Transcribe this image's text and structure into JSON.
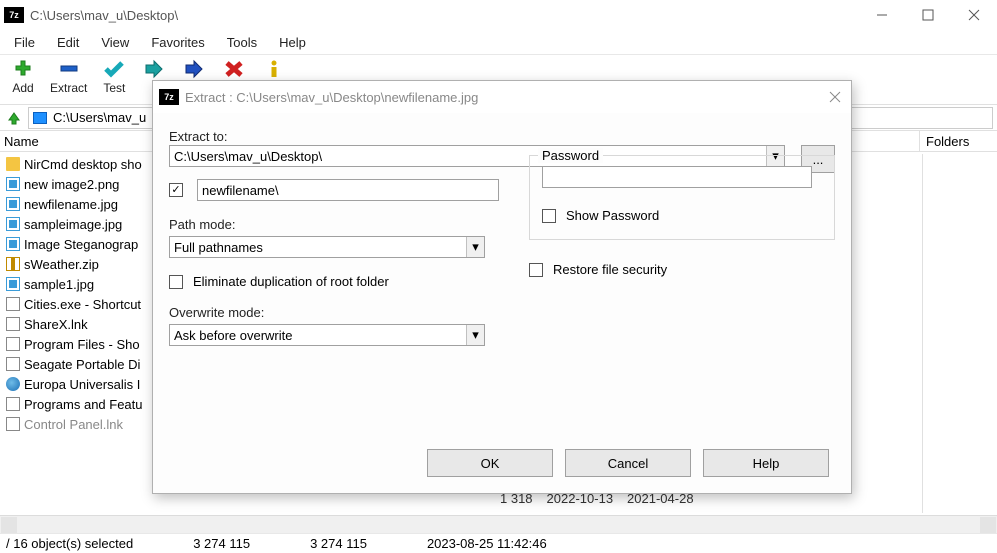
{
  "window": {
    "title": "C:\\Users\\mav_u\\Desktop\\",
    "app_badge": "7z"
  },
  "menu": {
    "items": [
      "File",
      "Edit",
      "View",
      "Favorites",
      "Tools",
      "Help"
    ]
  },
  "toolbar": {
    "add": "Add",
    "extract": "Extract",
    "test": "Test"
  },
  "address": "C:\\Users\\mav_u",
  "columns": {
    "left": "Name",
    "right": "Folders"
  },
  "files": [
    {
      "icon": "folder",
      "name": "NirCmd desktop sho"
    },
    {
      "icon": "img",
      "name": "new image2.png"
    },
    {
      "icon": "img",
      "name": "newfilename.jpg"
    },
    {
      "icon": "img",
      "name": "sampleimage.jpg"
    },
    {
      "icon": "img",
      "name": "Image Steganograp"
    },
    {
      "icon": "zip",
      "name": "sWeather.zip"
    },
    {
      "icon": "img",
      "name": "sample1.jpg"
    },
    {
      "icon": "lnk",
      "name": "Cities.exe - Shortcut"
    },
    {
      "icon": "lnk",
      "name": "ShareX.lnk"
    },
    {
      "icon": "lnk",
      "name": "Program Files - Sho"
    },
    {
      "icon": "lnk",
      "name": "Seagate Portable Di"
    },
    {
      "icon": "globe",
      "name": "Europa Universalis I"
    },
    {
      "icon": "lnk",
      "name": "Programs and Featu"
    },
    {
      "icon": "lnk",
      "name": "Control Panel.lnk",
      "faded": true
    }
  ],
  "extra_row": {
    "c1": "1 318",
    "c2": "2022-10-13",
    "c3": "2021-04-28"
  },
  "statusbar": {
    "sel": "/ 16 object(s) selected",
    "s1": "3 274 115",
    "s2": "3 274 115",
    "s3": "2023-08-25 11:42:46"
  },
  "dialog": {
    "title": "Extract : C:\\Users\\mav_u\\Desktop\\newfilename.jpg",
    "extract_to_label": "Extract to:",
    "extract_to_value": "C:\\Users\\mav_u\\Desktop\\",
    "browse": "...",
    "subfolder_value": "newfilename\\",
    "path_mode_label": "Path mode:",
    "path_mode_value": "Full pathnames",
    "eliminate_label": "Eliminate duplication of root folder",
    "overwrite_label": "Overwrite mode:",
    "overwrite_value": "Ask before overwrite",
    "password_label": "Password",
    "show_password_label": "Show Password",
    "restore_label": "Restore file security",
    "ok": "OK",
    "cancel": "Cancel",
    "help": "Help"
  }
}
